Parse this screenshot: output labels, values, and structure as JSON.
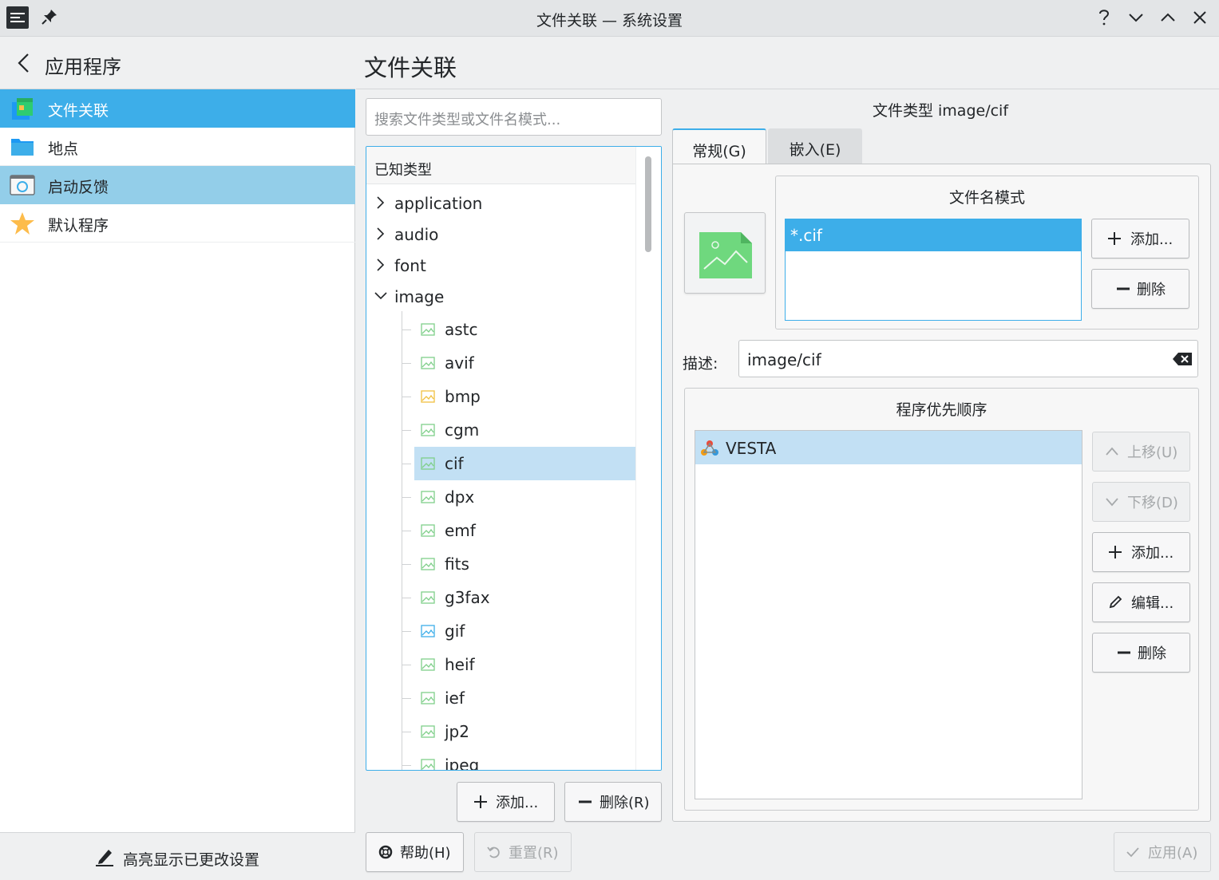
{
  "window": {
    "title": "文件关联 — 系统设置",
    "buttons": [
      "help",
      "minimize",
      "maximize",
      "close"
    ]
  },
  "sidebar": {
    "header": "应用程序",
    "items": [
      {
        "label": "文件关联",
        "icon": "file-associations-icon",
        "state": "selected"
      },
      {
        "label": "地点",
        "icon": "folder-icon",
        "state": "normal"
      },
      {
        "label": "启动反馈",
        "icon": "launch-feedback-icon",
        "state": "hover"
      },
      {
        "label": "默认程序",
        "icon": "star-icon",
        "state": "normal"
      }
    ],
    "footer": "高亮显示已更改设置"
  },
  "main": {
    "title": "文件关联",
    "search_placeholder": "搜索文件类型或文件名模式...",
    "tree": {
      "header": "已知类型",
      "groups": [
        {
          "label": "application",
          "expanded": false
        },
        {
          "label": "audio",
          "expanded": false
        },
        {
          "label": "font",
          "expanded": false
        },
        {
          "label": "image",
          "expanded": true
        }
      ],
      "children": [
        "astc",
        "avif",
        "bmp",
        "cgm",
        "cif",
        "dpx",
        "emf",
        "fits",
        "g3fax",
        "gif",
        "heif",
        "ief",
        "jp2",
        "jpeg"
      ],
      "selected": "cif"
    },
    "add_button": "添加...",
    "remove_button": "删除(R)",
    "help_button": "帮助(H)",
    "reset_button": "重置(R)",
    "apply_button": "应用(A)"
  },
  "detail": {
    "filetype_title": "文件类型 image/cif",
    "tabs": [
      "常规(G)",
      "嵌入(E)"
    ],
    "active_tab": "常规(G)",
    "patterns": {
      "title": "文件名模式",
      "items": [
        "*.cif"
      ],
      "add_button": "添加...",
      "remove_button": "删除"
    },
    "description": {
      "label": "描述:",
      "value": "image/cif"
    },
    "programs": {
      "title": "程序优先顺序",
      "items": [
        "VESTA"
      ],
      "move_up_button": "上移(U)",
      "move_down_button": "下移(D)",
      "add_button": "添加...",
      "edit_button": "编辑...",
      "remove_button": "删除"
    }
  },
  "colors": {
    "accent": "#3daee9",
    "selection_light": "#c2e0f4",
    "hover": "#93cee9",
    "window_bg": "#eff0f1"
  }
}
